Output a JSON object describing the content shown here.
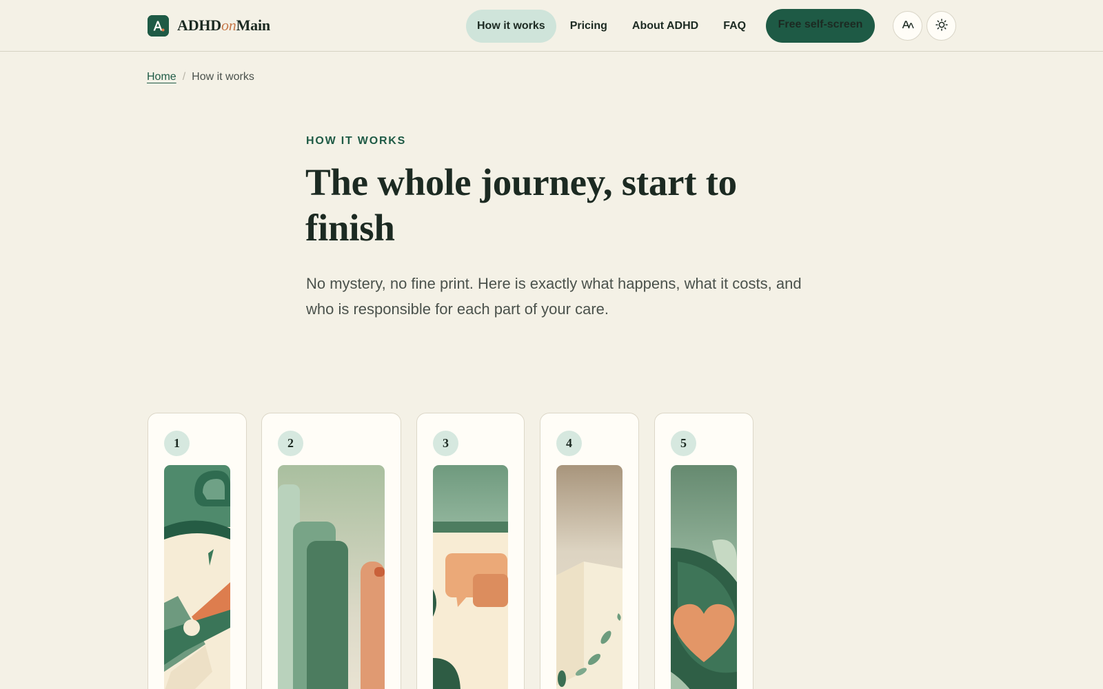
{
  "header": {
    "brand": {
      "prefix": "ADHD",
      "middle": "on",
      "suffix": "Main"
    },
    "nav": [
      {
        "label": "How it works",
        "active": true
      },
      {
        "label": "Pricing",
        "active": false
      },
      {
        "label": "About ADHD",
        "active": false
      },
      {
        "label": "FAQ",
        "active": false
      }
    ],
    "cta_label": "Free self-screen",
    "icons": {
      "brand": "brand-logo-a-icon",
      "font_size": "text-size-icon",
      "theme": "sun-icon"
    }
  },
  "breadcrumb": {
    "home": "Home",
    "separator": "/",
    "current": "How it works"
  },
  "hero": {
    "eyebrow": "HOW IT WORKS",
    "title": "The whole journey, start to finish",
    "lede": "No mystery, no fine print. Here is exactly what happens, what it costs, and who is responsible for each part of your care."
  },
  "steps": [
    {
      "number": "1",
      "art": "clock-illustration"
    },
    {
      "number": "2",
      "art": "forms-and-cup-illustration"
    },
    {
      "number": "3",
      "art": "chat-bubbles-illustration"
    },
    {
      "number": "4",
      "art": "package-illustration"
    },
    {
      "number": "5",
      "art": "heart-leaf-illustration"
    }
  ],
  "colors": {
    "page_bg": "#f4f1e6",
    "brand_green": "#1e5a45",
    "active_pill": "#cfe4da",
    "accent_orange": "#c7794a",
    "card_bg": "#fffdf7"
  }
}
